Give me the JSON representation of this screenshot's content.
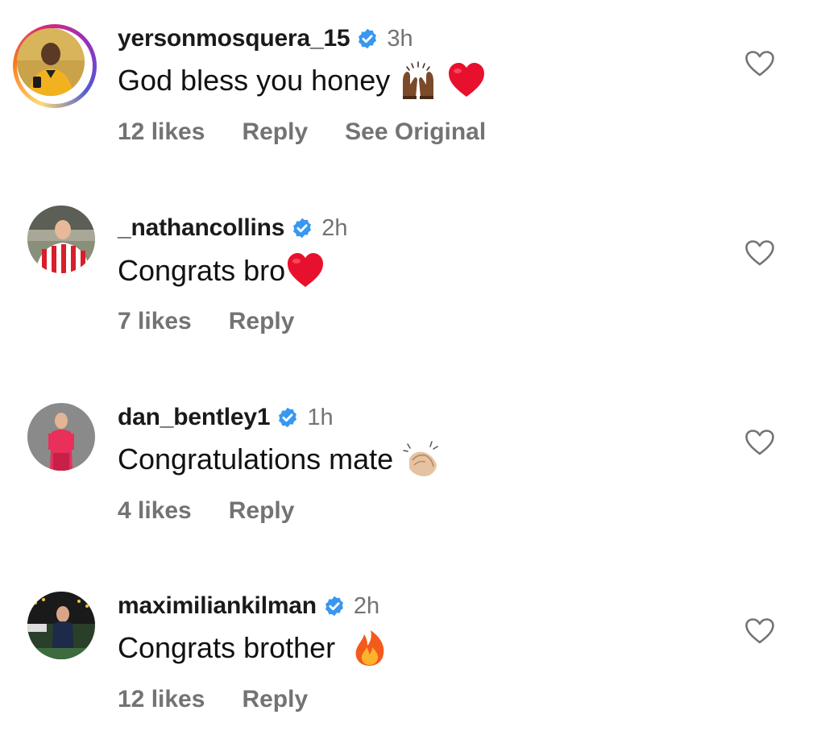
{
  "comments": [
    {
      "username": "yersonmosquera_15",
      "time": "3h",
      "text": "God bless you honey",
      "emojis": [
        "raised-hands-emoji",
        "red-heart-emoji"
      ],
      "likes": "12 likes",
      "reply_label": "Reply",
      "see_original_label": "See Original",
      "has_story_ring": true
    },
    {
      "username": "_nathancollins",
      "time": "2h",
      "text": "Congrats bro",
      "emojis": [
        "red-heart-emoji"
      ],
      "likes": "7 likes",
      "reply_label": "Reply"
    },
    {
      "username": "dan_bentley1",
      "time": "1h",
      "text": "Congratulations mate",
      "emojis": [
        "clapping-hands-emoji"
      ],
      "likes": "4 likes",
      "reply_label": "Reply"
    },
    {
      "username": "maximiliankilman",
      "time": "2h",
      "text": "Congrats brother",
      "emojis": [
        "fire-emoji"
      ],
      "likes": "12 likes",
      "reply_label": "Reply"
    }
  ],
  "icons": {
    "verified": "verified-badge-icon",
    "like": "heart-outline-icon"
  },
  "colors": {
    "verified_blue": "#3897f0",
    "secondary_text": "#737373",
    "primary_text": "#111111",
    "heart_red": "#e0245e"
  }
}
